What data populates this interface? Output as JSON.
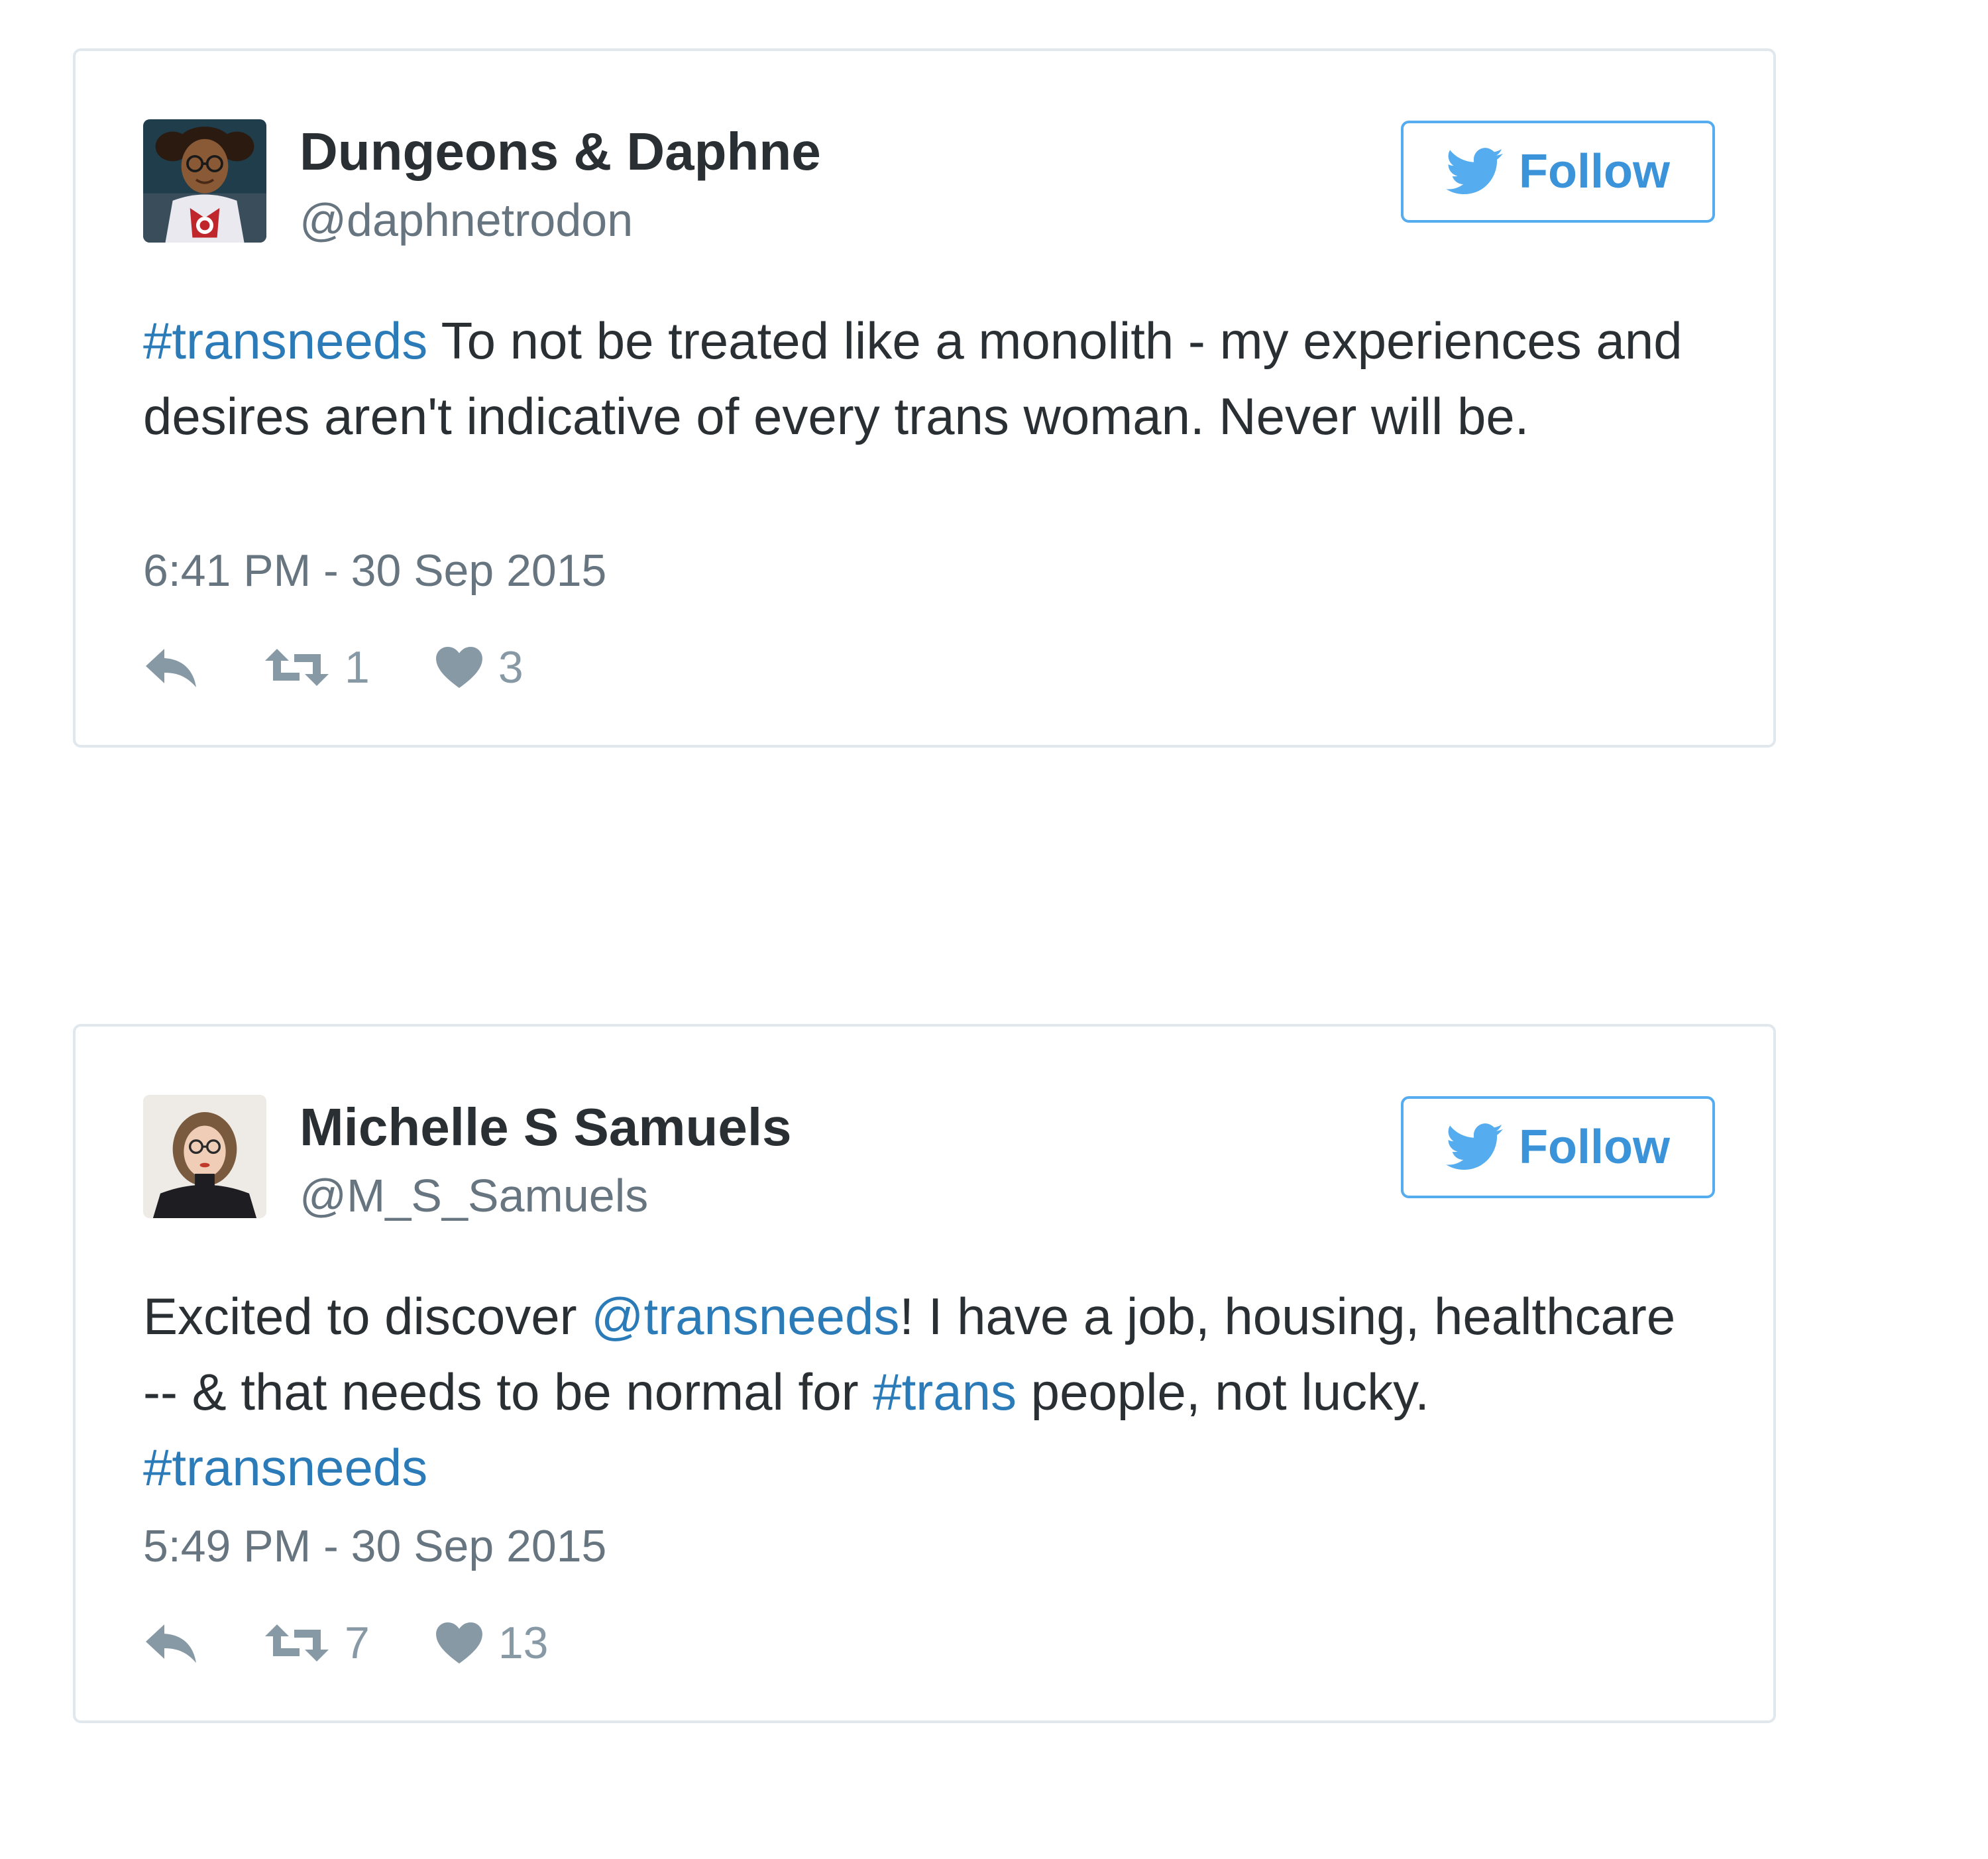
{
  "tweets": [
    {
      "display_name": "Dungeons & Daphne",
      "handle": "@daphnetrodon",
      "follow_label": "Follow",
      "text_parts": [
        {
          "text": "#transneeds",
          "link": true
        },
        {
          "text": " To not be treated like a monolith - my experiences and desires aren't indicative of every trans woman. Never will be.",
          "link": false
        }
      ],
      "timestamp": "6:41 PM - 30 Sep 2015",
      "retweets": "1",
      "likes": "3",
      "avatar_icon": "cartoon-avatar"
    },
    {
      "display_name": "Michelle S Samuels",
      "handle": "@M_S_Samuels",
      "follow_label": "Follow",
      "text_parts": [
        {
          "text": "Excited to discover ",
          "link": false
        },
        {
          "text": "@transneeds",
          "link": true
        },
        {
          "text": "! I have a job, housing, healthcare -- & that needs to be normal for ",
          "link": false
        },
        {
          "text": "#trans",
          "link": true
        },
        {
          "text": " people, not lucky. ",
          "link": false
        },
        {
          "text": "#transneeds",
          "link": true
        }
      ],
      "timestamp": "5:49 PM - 30 Sep 2015",
      "retweets": "7",
      "likes": "13",
      "avatar_icon": "photo-avatar"
    }
  ],
  "icons": {
    "follow": "twitter-bird-icon",
    "reply": "reply-icon",
    "retweet": "retweet-icon",
    "like": "heart-icon"
  },
  "colors": {
    "link": "#2b7bb9",
    "follow_border": "#55acee",
    "text": "#292f33",
    "muted": "#66757f",
    "action_icons": "#8899a6"
  }
}
